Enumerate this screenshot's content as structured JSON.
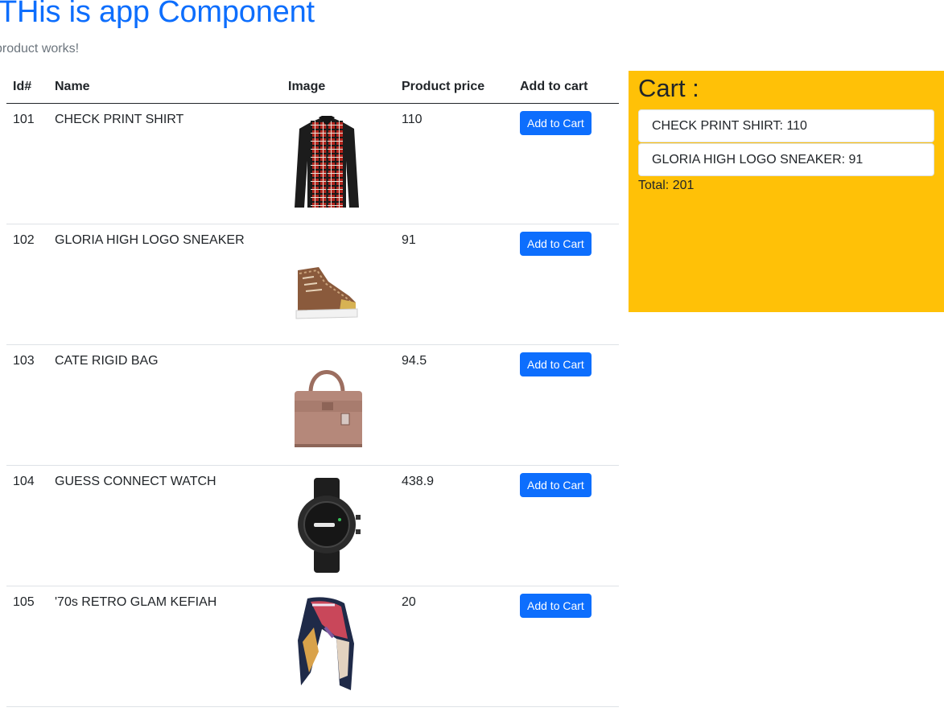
{
  "header": {
    "title": "THis is app Component",
    "subtitle": "product works!"
  },
  "table": {
    "columns": [
      "Id#",
      "Name",
      "Image",
      "Product price",
      "Add to cart"
    ],
    "rows": [
      {
        "id": "101",
        "name": "CHECK PRINT SHIRT",
        "image": "shirt-image",
        "price": "110",
        "button": "Add to Cart"
      },
      {
        "id": "102",
        "name": "GLORIA HIGH LOGO SNEAKER",
        "image": "sneaker-image",
        "price": "91",
        "button": "Add to Cart"
      },
      {
        "id": "103",
        "name": "CATE RIGID BAG",
        "image": "bag-image",
        "price": "94.5",
        "button": "Add to Cart"
      },
      {
        "id": "104",
        "name": "GUESS CONNECT WATCH",
        "image": "watch-image",
        "price": "438.9",
        "button": "Add to Cart"
      },
      {
        "id": "105",
        "name": "'70s RETRO GLAM KEFIAH",
        "image": "scarf-image",
        "price": "20",
        "button": "Add to Cart"
      }
    ]
  },
  "cart": {
    "title": "Cart :",
    "items": [
      "CHECK PRINT SHIRT: 110",
      "GLORIA HIGH LOGO SNEAKER: 91"
    ],
    "total": "Total: 201"
  },
  "colors": {
    "primary": "#0d6efd",
    "cart_background": "#ffc107",
    "muted_text": "#6c757d"
  }
}
